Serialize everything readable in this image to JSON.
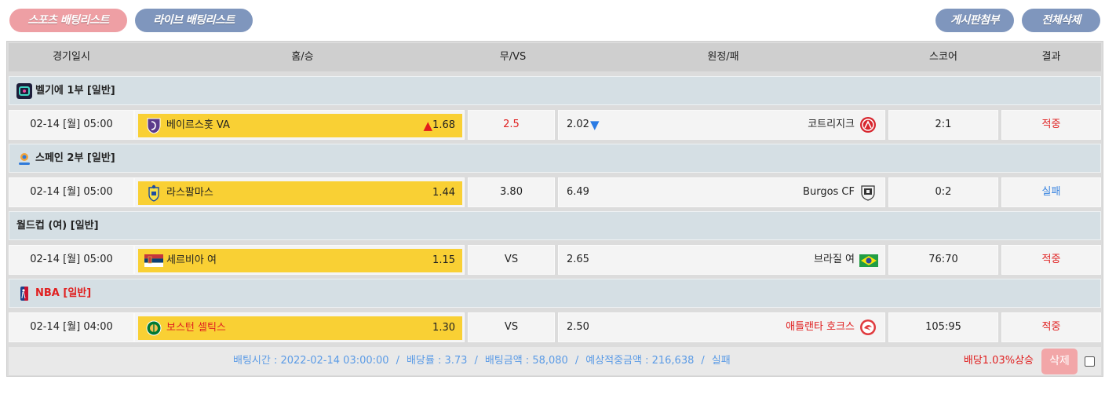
{
  "topbar": {
    "sports_tab": "스포츠 배팅리스트",
    "live_tab": "라이브 배팅리스트",
    "attach_button": "게시판첨부",
    "delete_all_button": "전체삭제"
  },
  "headers": {
    "datetime": "경기일시",
    "home": "홈/승",
    "draw": "무/VS",
    "away": "원정/패",
    "score": "스코어",
    "result": "결과"
  },
  "games": [
    {
      "league": "벨기에 1부 [일반]",
      "league_icon": "belgian-league-icon",
      "league_color": "#222222",
      "datetime": "02-14 [월] 05:00",
      "home_team": "베이르스홋 VA",
      "home_logo": "beerschot-logo-icon",
      "home_odds": "1.68",
      "home_trend": "up",
      "draw": "2.5",
      "away_odds": "2.02",
      "away_trend": "down",
      "away_team": "코트리지크",
      "away_logo": "kortrijk-logo-icon",
      "score": "2:1",
      "result": "적중",
      "result_type": "hit"
    },
    {
      "league": "스페인 2부 [일반]",
      "league_icon": "laliga2-league-icon",
      "league_color": "#222222",
      "datetime": "02-14 [월] 05:00",
      "home_team": "라스팔마스",
      "home_logo": "las-palmas-logo-icon",
      "home_odds": "1.44",
      "draw": "3.80",
      "away_odds": "6.49",
      "away_team": "Burgos CF",
      "away_logo": "burgos-logo-icon",
      "score": "0:2",
      "result": "실패",
      "result_type": "miss"
    },
    {
      "league": "월드컵 (여) [일반]",
      "league_icon": "",
      "league_color": "#222222",
      "datetime": "02-14 [월] 05:00",
      "home_team": "세르비아 여",
      "home_logo": "serbia-flag-icon",
      "home_odds": "1.15",
      "draw": "VS",
      "away_odds": "2.65",
      "away_team": "브라질 여",
      "away_logo": "brazil-flag-icon",
      "score": "76:70",
      "result": "적중",
      "result_type": "hit"
    },
    {
      "league": "NBA [일반]",
      "league_icon": "nba-league-icon",
      "league_color": "#e02020",
      "datetime": "02-14 [월] 04:00",
      "home_team": "보스턴 셀틱스",
      "home_logo": "celtics-logo-icon",
      "home_odds": "1.30",
      "draw": "VS",
      "away_odds": "2.50",
      "away_team": "애틀랜타 호크스",
      "away_logo": "hawks-logo-icon",
      "score": "105:95",
      "result": "적중",
      "result_type": "hit"
    }
  ],
  "footer": {
    "bet_time": "배팅시간 : 2022-02-14 03:00:00",
    "odds": "배당률 : 3.73",
    "bet_amount": "배팅금액 : 58,080",
    "expected_amount": "예상적중금액 : 216,638",
    "status": "실패",
    "separator": "/",
    "odds_rise": "배당1.03%상승",
    "delete_button": "삭제"
  },
  "colors": {
    "pink_pill": "#ee9fa4",
    "blue_pill": "#7f96bd",
    "home_highlight": "#f9d034",
    "league_row": "#d5dfe4",
    "hit": "#e02020",
    "miss": "#3a85e0",
    "info_text": "#5b9be6"
  }
}
